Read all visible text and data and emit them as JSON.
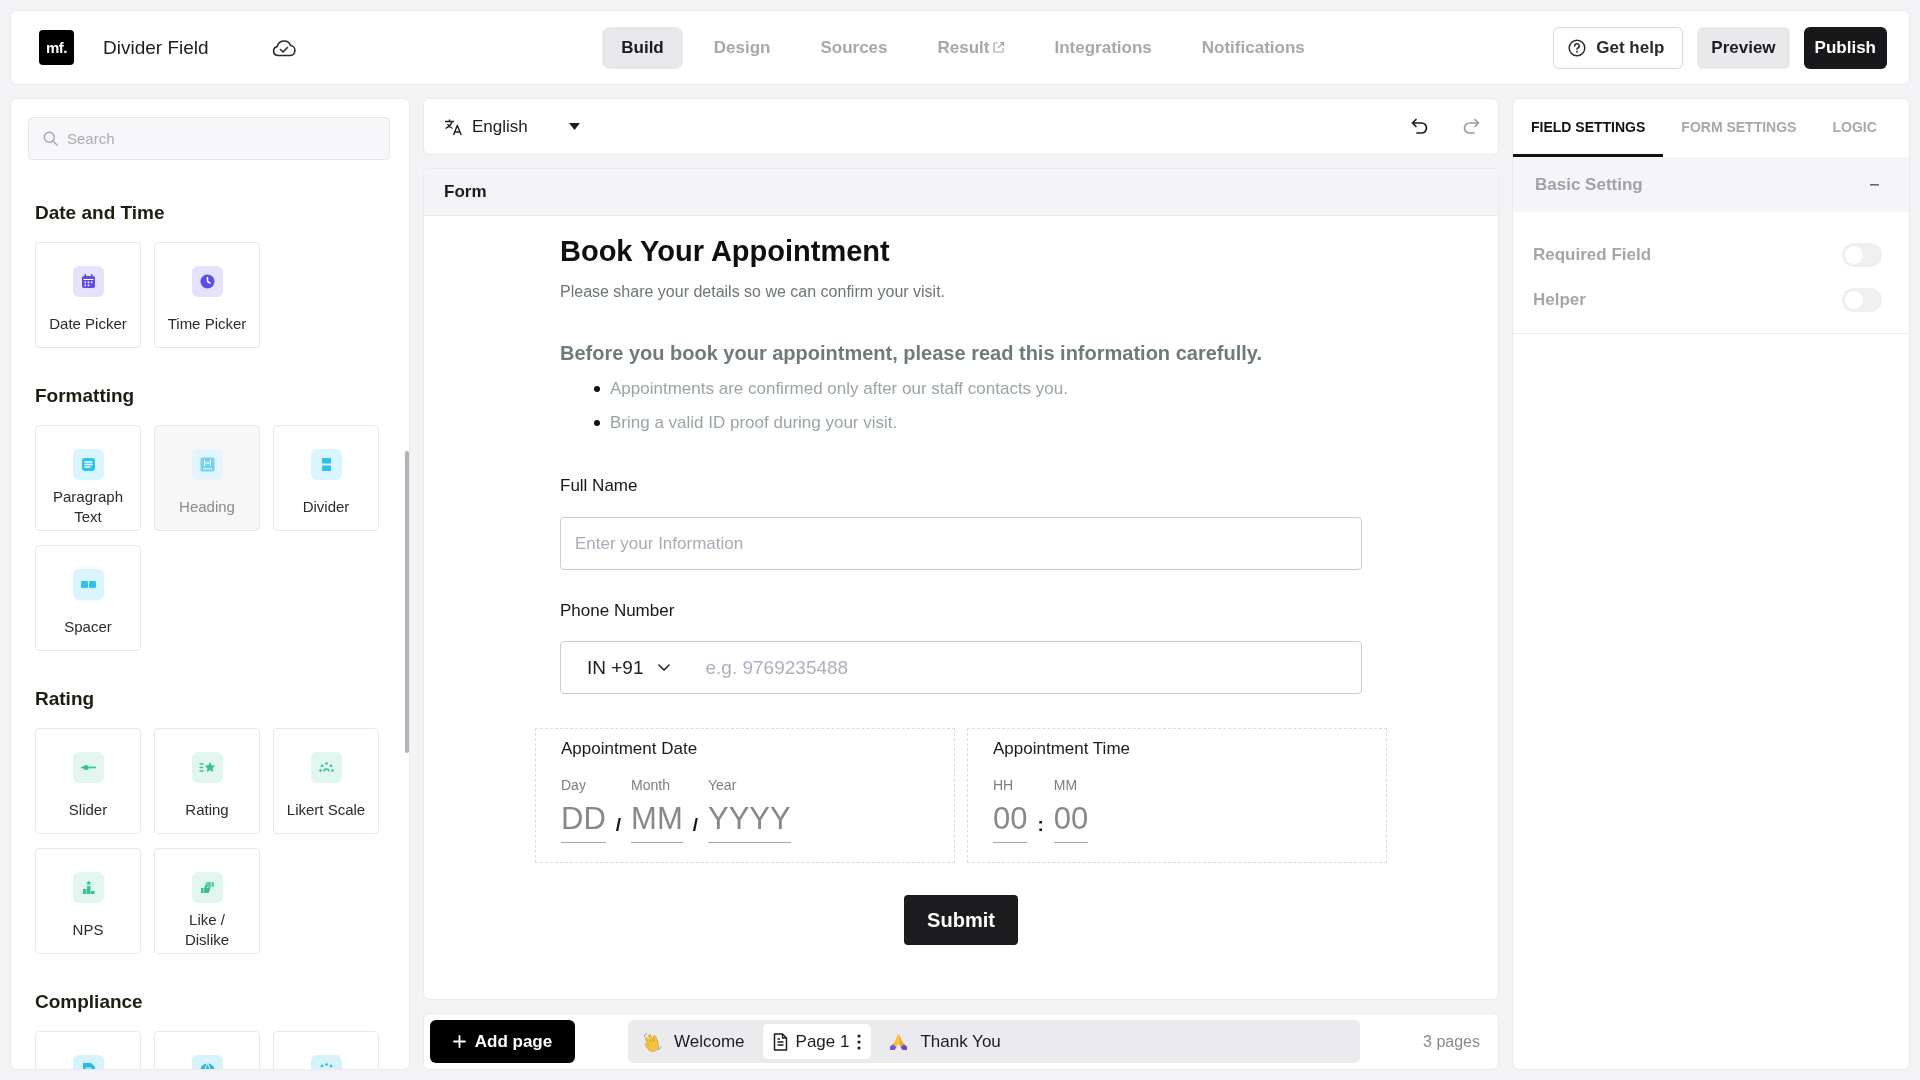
{
  "app_bar": {
    "logo": "mf.",
    "form_name": "Divider Field",
    "nav": [
      {
        "label": "Build",
        "selected": true,
        "external": false
      },
      {
        "label": "Design",
        "selected": false,
        "external": false
      },
      {
        "label": "Sources",
        "selected": false,
        "external": false
      },
      {
        "label": "Result",
        "selected": false,
        "external": true
      },
      {
        "label": "Integrations",
        "selected": false,
        "external": false
      },
      {
        "label": "Notifications",
        "selected": false,
        "external": false
      }
    ],
    "actions": [
      {
        "label": "Get help",
        "kind": "help"
      },
      {
        "label": "Preview",
        "kind": "secondary"
      },
      {
        "label": "Publish",
        "kind": "primary"
      }
    ]
  },
  "field_palette": {
    "search": {
      "placeholder": "Search"
    },
    "sections": [
      {
        "title": "Date and Time",
        "items": [
          {
            "label": "Date Picker",
            "disabled": false
          },
          {
            "label": "Time Picker",
            "disabled": false
          }
        ]
      },
      {
        "title": "Formatting",
        "items": [
          {
            "label": "Paragraph Text",
            "disabled": false
          },
          {
            "label": "Heading",
            "disabled": true
          },
          {
            "label": "Divider",
            "disabled": false
          },
          {
            "label": "Spacer",
            "disabled": false
          }
        ]
      },
      {
        "title": "Rating",
        "items": [
          {
            "label": "Slider",
            "disabled": false
          },
          {
            "label": "Rating",
            "disabled": false
          },
          {
            "label": "Likert Scale",
            "disabled": false
          },
          {
            "label": "NPS",
            "disabled": false
          },
          {
            "label": "Like / Dislike",
            "disabled": false
          }
        ]
      },
      {
        "title": "Compliance",
        "items": [
          {
            "disabled": false
          },
          {
            "disabled": false
          },
          {
            "disabled": false
          }
        ]
      }
    ]
  },
  "toolbar": {
    "language": "English",
    "history": [
      {
        "kind": "undo",
        "disabled": false
      },
      {
        "kind": "redo",
        "disabled": true
      }
    ]
  },
  "form": {
    "tab": "Form",
    "title": "Book Your Appointment",
    "subtitle": "Please share your details so we can confirm your visit.",
    "notice": {
      "heading": "Before you book your appointment, please read this information carefully.",
      "bullets": [
        "Appointments are confirmed only after our staff contacts you.",
        "Bring a valid ID proof during your visit."
      ]
    },
    "fields": [
      {
        "kind": "text",
        "label": "Full Name",
        "placeholder": "Enter your Information"
      },
      {
        "kind": "phone",
        "label": "Phone Number",
        "country": "IN +91",
        "placeholder": "e.g. 9769235488"
      }
    ],
    "pickers": [
      {
        "label": "Appointment Date",
        "parts": [
          {
            "label": "Day",
            "placeholder": "DD"
          },
          {
            "label": "Month",
            "placeholder": "MM"
          },
          {
            "label": "Year",
            "placeholder": "YYYY"
          }
        ],
        "separators": [
          "/",
          "/"
        ]
      },
      {
        "label": "Appointment Time",
        "parts": [
          {
            "label": "HH",
            "placeholder": "00"
          },
          {
            "label": "MM",
            "placeholder": "00"
          }
        ],
        "separators": [
          ":"
        ]
      }
    ],
    "submit": "Submit"
  },
  "pages_bar": {
    "add_page": "Add page",
    "pages": [
      {
        "kind": "welcome",
        "label": "Welcome",
        "selected": false
      },
      {
        "kind": "page",
        "label": "Page 1",
        "selected": true
      },
      {
        "kind": "ending",
        "label": "Thank You",
        "selected": false
      }
    ],
    "page_count": "3 pages"
  },
  "settings_panel": {
    "tabs": [
      {
        "label": "FIELD SETTINGS",
        "selected": true
      },
      {
        "label": "FORM SETTINGS",
        "selected": false
      },
      {
        "label": "LOGIC",
        "selected": false
      }
    ],
    "section": {
      "title": "Basic Setting",
      "expanded": true,
      "settings": [
        {
          "label": "Required Field",
          "on": false
        },
        {
          "label": "Helper",
          "on": false
        }
      ]
    }
  }
}
